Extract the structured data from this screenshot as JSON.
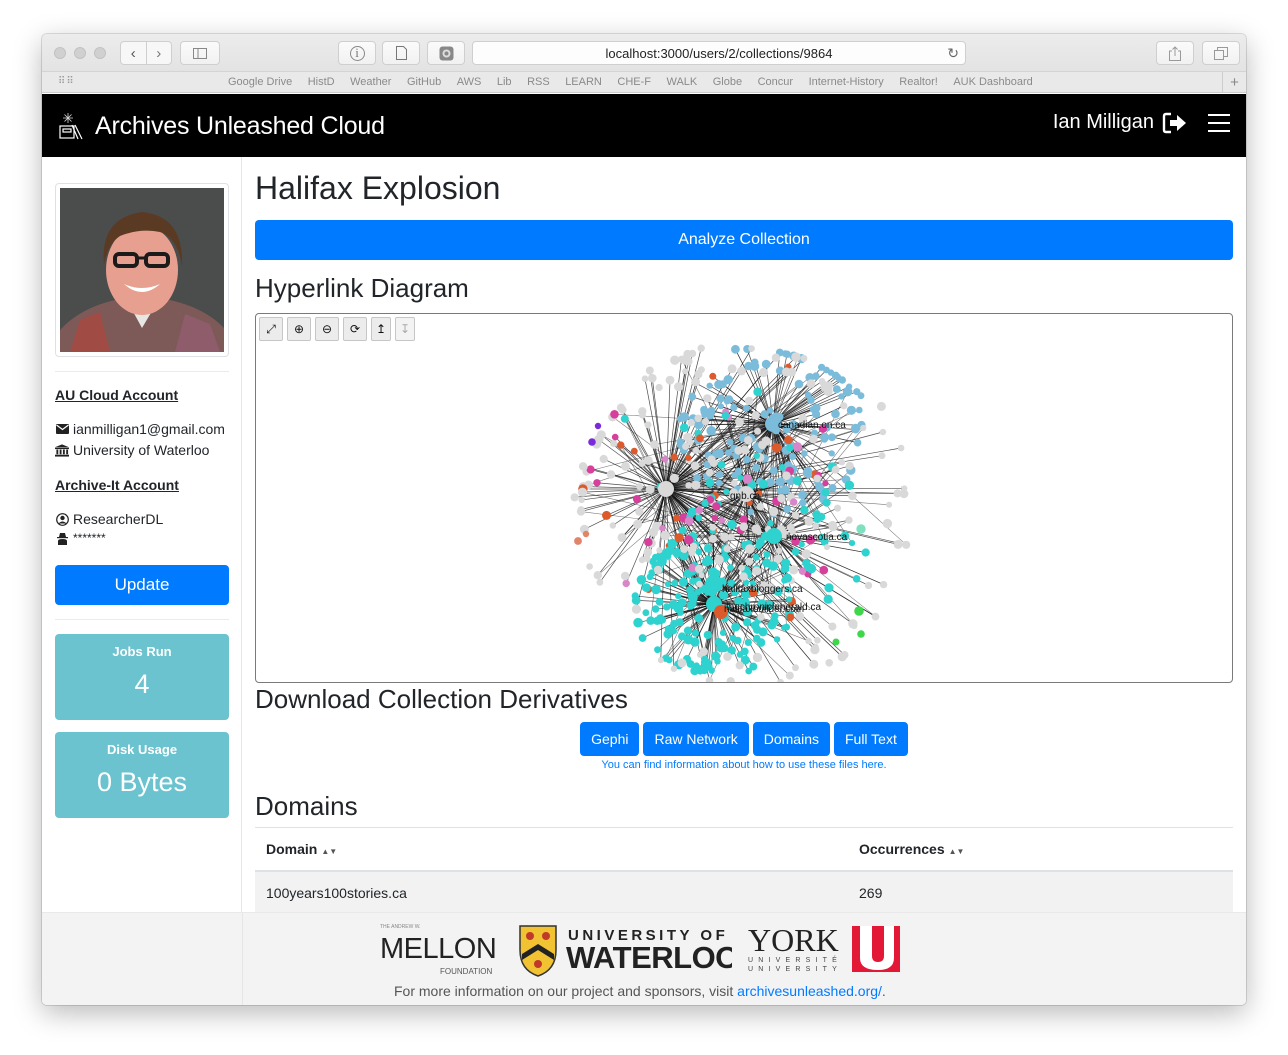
{
  "browser": {
    "url": "localhost:3000/users/2/collections/9864",
    "bookmarks": [
      "Google Drive",
      "HistD",
      "Weather",
      "GitHub",
      "AWS",
      "Lib",
      "RSS",
      "LEARN",
      "CHE-F",
      "WALK",
      "Globe",
      "Concur",
      "Internet-History",
      "Realtor!",
      "AUK Dashboard"
    ]
  },
  "navbar": {
    "brand": "Archives Unleashed Cloud",
    "user_name": "Ian Milligan",
    "signout_icon": "sign-out-icon",
    "menu_icon": "hamburger-icon"
  },
  "sidebar": {
    "au_account_heading": "AU Cloud Account",
    "email": "ianmilligan1@gmail.com",
    "institution": "University of Waterloo",
    "archive_it_heading": "Archive-It Account",
    "archive_it_user": "ResearcherDL",
    "archive_it_password": "*******",
    "update_label": "Update",
    "stats": [
      {
        "label": "Jobs Run",
        "value": "4"
      },
      {
        "label": "Disk Usage",
        "value": "0 Bytes"
      }
    ]
  },
  "main": {
    "title": "Halifax Explosion",
    "analyze_label": "Analyze Collection",
    "hyperlink_heading": "Hyperlink Diagram",
    "graph_tools": [
      {
        "name": "fullscreen-icon",
        "glyph": "⤢"
      },
      {
        "name": "zoom-in-icon",
        "glyph": "⊕"
      },
      {
        "name": "zoom-out-icon",
        "glyph": "⊖"
      },
      {
        "name": "refresh-icon",
        "glyph": "⟳"
      },
      {
        "name": "arrow-up-icon",
        "glyph": "↥"
      },
      {
        "name": "arrow-down-icon",
        "glyph": "↧"
      }
    ],
    "graph_labels": [
      "canadian.on.ca",
      "gnb.ca",
      "novascotia.ca",
      "halifaxbloggers.ca",
      "thechronicleherald.ca",
      "haligonia.ca",
      "halifaxbuilder.com"
    ],
    "graph_colors": {
      "blue": "#7bbcdb",
      "cyan": "#2ed3cf",
      "gray": "#d9d9d9",
      "orange": "#dd5a2d",
      "pink": "#d63f9c",
      "lilac": "#d885c9",
      "purple": "#7a2bd9",
      "green": "#3ed64a",
      "mint": "#7fe0c0",
      "salmon": "#e0856a"
    },
    "derivatives_heading": "Download Collection Derivatives",
    "derivative_buttons": [
      "Gephi",
      "Raw Network",
      "Domains",
      "Full Text"
    ],
    "derivatives_note": "You can find information about how to use these files here.",
    "domains_heading": "Domains",
    "domains_table": {
      "columns": [
        "Domain",
        "Occurrences"
      ],
      "rows": [
        {
          "domain": "100years100stories.ca",
          "occurrences": "269"
        }
      ]
    }
  },
  "footer": {
    "text": "For more information on our project and sponsors, visit ",
    "link": "archivesunleashed.org/",
    "after_link": ".",
    "sponsors": {
      "mellon_top": "THE ANDREW W.",
      "mellon_name": "MELLON",
      "mellon_bottom": "FOUNDATION",
      "uw_top": "UNIVERSITY OF",
      "uw_name": "WATERLOO",
      "york_name": "YORK",
      "york_fr": "UNIVERSITÉ",
      "york_en": "UNIVERSITY",
      "york_mark": "U"
    }
  }
}
